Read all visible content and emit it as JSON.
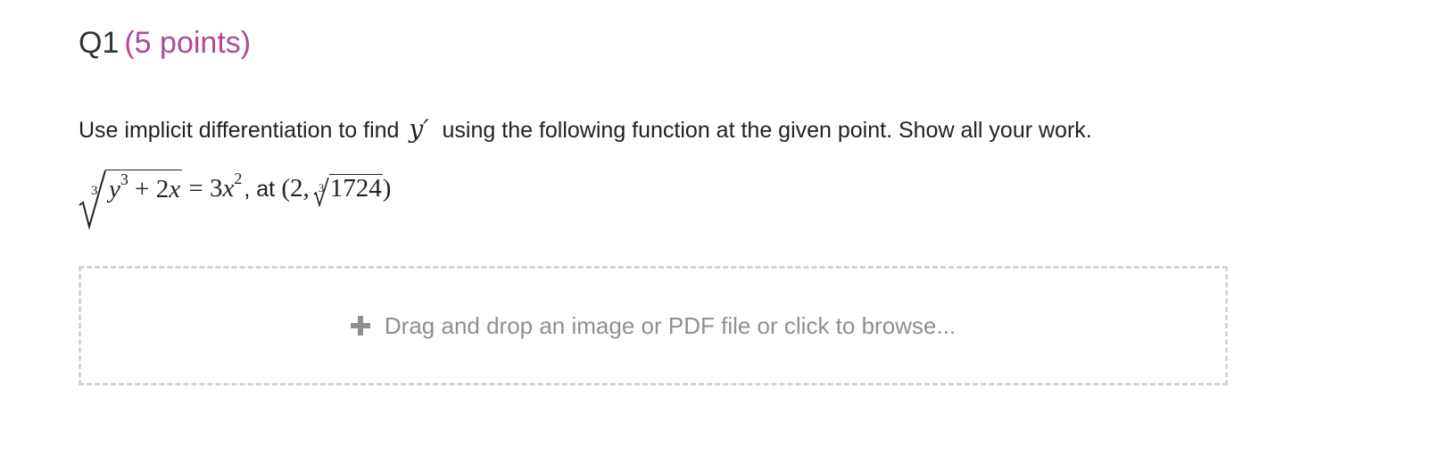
{
  "question": {
    "number": "Q1",
    "points": "(5 points)"
  },
  "prompt": {
    "before": "Use implicit differentiation to find",
    "variable": "y′",
    "after": "using the following function at the given point. Show all your work."
  },
  "equation": {
    "root_index": "3",
    "radicand_var": "y",
    "radicand_exp": "3",
    "radicand_rest": "+ 2",
    "radicand_x": "x",
    "equals": "= 3",
    "rhs_var": "x",
    "rhs_exp": "2",
    "at_text": ", at",
    "point_open": "(2,",
    "point_root_index": "3",
    "point_radicand": "1724",
    "point_close": ")"
  },
  "upload": {
    "label": "Drag and drop an image or PDF file or click to browse...",
    "icon": "plus-icon"
  },
  "colors": {
    "points": "#b04a94",
    "dropzone_border": "#d6d6d6",
    "dropzone_text": "#8f8f8f"
  }
}
